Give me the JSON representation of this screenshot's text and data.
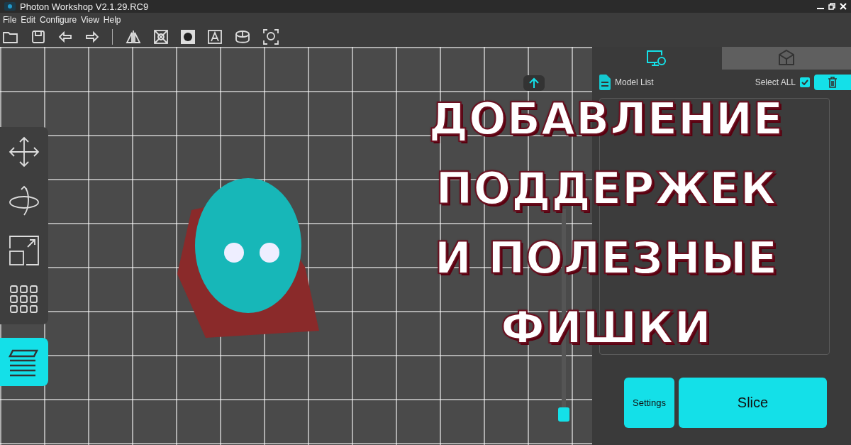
{
  "window": {
    "title": "Photon Workshop V2.1.29.RC9"
  },
  "menu": [
    "File",
    "Edit",
    "Configure",
    "View",
    "Help"
  ],
  "overlay_title": [
    "ДОБАВЛЕНИЕ",
    "ПОДДЕРЖЕК",
    "И ПОЛЕЗНЫЕ",
    "ФИШКИ"
  ],
  "layer_slider": {
    "level": 0
  },
  "side_tools": [
    {
      "kind": "move",
      "selected": false
    },
    {
      "kind": "rotate",
      "selected": false
    },
    {
      "kind": "scale",
      "selected": false
    },
    {
      "kind": "arrange",
      "selected": false
    },
    {
      "kind": "layers",
      "selected": true
    }
  ],
  "panel_tabs": [
    {
      "kind": "settings",
      "selected": true
    },
    {
      "kind": "model",
      "selected": false
    }
  ],
  "model_list": {
    "title": "Model List",
    "select_all_label": "Select ALL",
    "select_all_checked": true
  },
  "buttons": [
    {
      "label": "Settings",
      "kind": "small"
    },
    {
      "label": "Slice",
      "kind": "large"
    }
  ]
}
